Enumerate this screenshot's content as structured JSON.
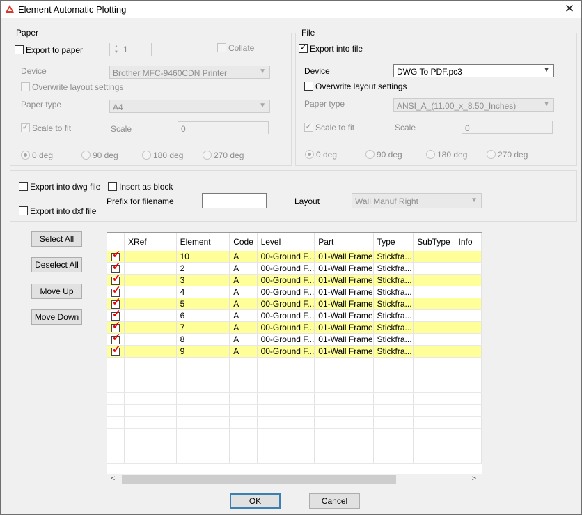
{
  "window": {
    "title": "Element Automatic Plotting",
    "close_glyph": "✕"
  },
  "paper": {
    "label": "Paper",
    "export_to_paper": {
      "label": "Export to paper",
      "checked": false
    },
    "copies": "1",
    "collate": {
      "label": "Collate",
      "checked": false
    },
    "device_label": "Device",
    "device_value": "Brother MFC-9460CDN Printer",
    "overwrite": {
      "label": "Overwrite layout settings",
      "checked": false
    },
    "paper_type_label": "Paper type",
    "paper_type_value": "A4",
    "scale_to_fit": {
      "label": "Scale to fit",
      "checked": true
    },
    "scale_label": "Scale",
    "scale_value": "0",
    "rotations": [
      "0 deg",
      "90 deg",
      "180 deg",
      "270 deg"
    ],
    "rotation_selected": "0 deg"
  },
  "file": {
    "label": "File",
    "export_into_file": {
      "label": "Export into file",
      "checked": true
    },
    "device_label": "Device",
    "device_value": "DWG To PDF.pc3",
    "overwrite": {
      "label": "Overwrite layout settings",
      "checked": false
    },
    "paper_type_label": "Paper type",
    "paper_type_value": "ANSI_A_(11.00_x_8.50_Inches)",
    "scale_to_fit": {
      "label": "Scale to fit",
      "checked": true
    },
    "scale_label": "Scale",
    "scale_value": "0",
    "rotations": [
      "0 deg",
      "90 deg",
      "180 deg",
      "270 deg"
    ],
    "rotation_selected": "0 deg"
  },
  "export": {
    "dwg": {
      "label": "Export into dwg file",
      "checked": false
    },
    "dxf": {
      "label": "Export into dxf file",
      "checked": false
    },
    "insert_block": {
      "label": "Insert as block",
      "checked": false
    },
    "prefix_label": "Prefix for filename",
    "prefix_value": "",
    "layout_label": "Layout",
    "layout_value": "Wall Manuf Right"
  },
  "side_buttons": {
    "select_all": "Select All",
    "deselect_all": "Deselect All",
    "move_up": "Move Up",
    "move_down": "Move Down"
  },
  "grid": {
    "columns": [
      "",
      "XRef",
      "Element",
      "Code",
      "Level",
      "Part",
      "Type",
      "SubType",
      "Info"
    ],
    "rows": [
      {
        "checked": true,
        "xref": "",
        "element": "10",
        "code": "A",
        "level": "00-Ground F...",
        "part": "01-Wall Frame",
        "type": "Stickfra...",
        "subtype": "",
        "info": ""
      },
      {
        "checked": true,
        "xref": "",
        "element": "2",
        "code": "A",
        "level": "00-Ground F...",
        "part": "01-Wall Frame",
        "type": "Stickfra...",
        "subtype": "",
        "info": ""
      },
      {
        "checked": true,
        "xref": "",
        "element": "3",
        "code": "A",
        "level": "00-Ground F...",
        "part": "01-Wall Frame",
        "type": "Stickfra...",
        "subtype": "",
        "info": ""
      },
      {
        "checked": true,
        "xref": "",
        "element": "4",
        "code": "A",
        "level": "00-Ground F...",
        "part": "01-Wall Frame",
        "type": "Stickfra...",
        "subtype": "",
        "info": ""
      },
      {
        "checked": true,
        "xref": "",
        "element": "5",
        "code": "A",
        "level": "00-Ground F...",
        "part": "01-Wall Frame",
        "type": "Stickfra...",
        "subtype": "",
        "info": ""
      },
      {
        "checked": true,
        "xref": "",
        "element": "6",
        "code": "A",
        "level": "00-Ground F...",
        "part": "01-Wall Frame",
        "type": "Stickfra...",
        "subtype": "",
        "info": ""
      },
      {
        "checked": true,
        "xref": "",
        "element": "7",
        "code": "A",
        "level": "00-Ground F...",
        "part": "01-Wall Frame",
        "type": "Stickfra...",
        "subtype": "",
        "info": ""
      },
      {
        "checked": true,
        "xref": "",
        "element": "8",
        "code": "A",
        "level": "00-Ground F...",
        "part": "01-Wall Frame",
        "type": "Stickfra...",
        "subtype": "",
        "info": ""
      },
      {
        "checked": true,
        "xref": "",
        "element": "9",
        "code": "A",
        "level": "00-Ground F...",
        "part": "01-Wall Frame",
        "type": "Stickfra...",
        "subtype": "",
        "info": ""
      }
    ],
    "highlight_color": "#ffff99",
    "check_color": "#e00000"
  },
  "buttons": {
    "ok": "OK",
    "cancel": "Cancel"
  },
  "colors": {
    "accent_border": "#3c7fb1",
    "dialog_bg": "#f0f0f0",
    "app_icon": "#d93a2b"
  }
}
